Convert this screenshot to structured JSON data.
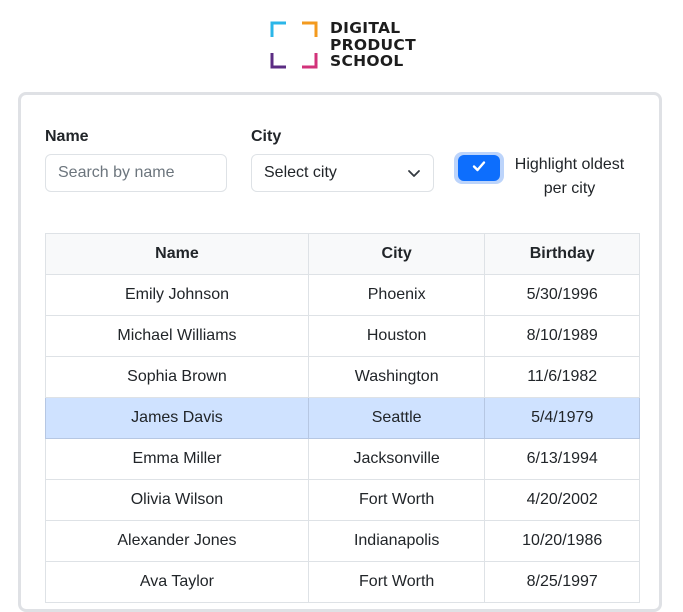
{
  "logo": {
    "lines": [
      "DIGITAL",
      "PRODUCT",
      "SCHOOL"
    ]
  },
  "filters": {
    "name_label": "Name",
    "name_placeholder": "Search by name",
    "name_value": "",
    "city_label": "City",
    "city_selected": "Select city",
    "highlight_label": "Highlight oldest per city",
    "highlight_checked": true
  },
  "colors": {
    "accent": "#0d6efd",
    "highlight_row": "#cfe2ff",
    "logo_cyan": "#2bb6e8",
    "logo_orange": "#f39a1e",
    "logo_purple": "#5b2c83",
    "logo_pink": "#d2327a"
  },
  "table": {
    "headers": [
      "Name",
      "City",
      "Birthday"
    ],
    "rows": [
      {
        "name": "Emily Johnson",
        "city": "Phoenix",
        "birthday": "5/30/1996",
        "highlighted": false
      },
      {
        "name": "Michael Williams",
        "city": "Houston",
        "birthday": "8/10/1989",
        "highlighted": false
      },
      {
        "name": "Sophia Brown",
        "city": "Washington",
        "birthday": "11/6/1982",
        "highlighted": false
      },
      {
        "name": "James Davis",
        "city": "Seattle",
        "birthday": "5/4/1979",
        "highlighted": true
      },
      {
        "name": "Emma Miller",
        "city": "Jacksonville",
        "birthday": "6/13/1994",
        "highlighted": false
      },
      {
        "name": "Olivia Wilson",
        "city": "Fort Worth",
        "birthday": "4/20/2002",
        "highlighted": false
      },
      {
        "name": "Alexander Jones",
        "city": "Indianapolis",
        "birthday": "10/20/1986",
        "highlighted": false
      },
      {
        "name": "Ava Taylor",
        "city": "Fort Worth",
        "birthday": "8/25/1997",
        "highlighted": false
      }
    ]
  }
}
